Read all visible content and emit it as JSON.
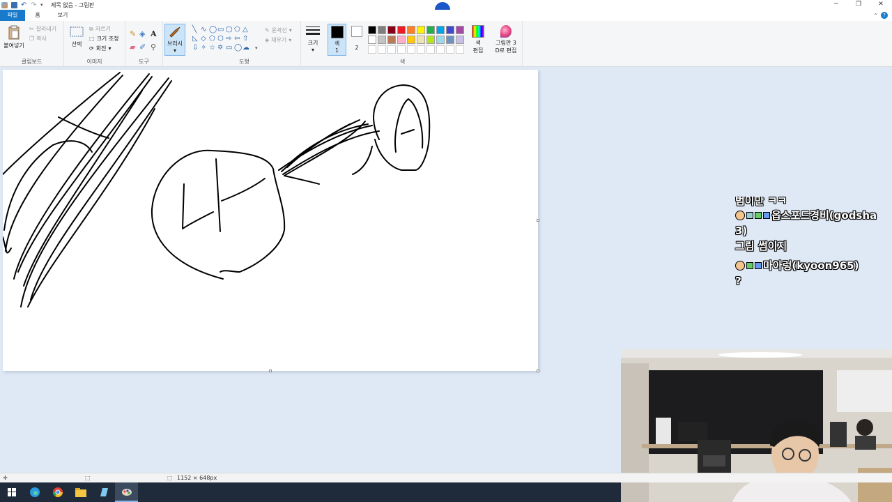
{
  "window": {
    "title": "제목 없음 - 그림판",
    "minimize": "─",
    "maximize": "❐",
    "close": "✕"
  },
  "tabs": [
    "파일",
    "홈",
    "보기"
  ],
  "ribbon": {
    "clipboard": {
      "label": "클립보드",
      "paste": "붙여넣기",
      "cut": "잘라내기",
      "copy": "복사"
    },
    "image": {
      "label": "이미지",
      "select": "선택",
      "crop": "자르기",
      "resize": "크기 조정",
      "rotate": "회전"
    },
    "tools": {
      "label": "도구"
    },
    "brushes": {
      "label": "브러시"
    },
    "shapes": {
      "label": "도형",
      "outline": "윤곽선",
      "fill": "채우기"
    },
    "size": {
      "label": "크기"
    },
    "colors": {
      "label": "색",
      "color1": "색\n1",
      "color1_a": "색",
      "color1_b": "1",
      "color2": "2",
      "edit_colors_a": "색",
      "edit_colors_b": "편집",
      "paint3d_a": "그림판 3",
      "paint3d_b": "D로 편집",
      "palette_row1": [
        "#000000",
        "#7f7f7f",
        "#880015",
        "#ed1c24",
        "#ff7f27",
        "#fff200",
        "#22b14c",
        "#00a2e8",
        "#3f48cc",
        "#a349a4"
      ],
      "palette_row2": [
        "#ffffff",
        "#c3c3c3",
        "#b97a57",
        "#ffaec9",
        "#ffc90e",
        "#efe4b0",
        "#b5e61d",
        "#99d9ea",
        "#7092be",
        "#c8bfe7"
      ]
    }
  },
  "status": {
    "canvas_size": "1152 × 648px"
  },
  "chat": {
    "partial_line": "범이만 ㅋㅋ",
    "messages": [
      {
        "user": "옵스포드경비(godsha",
        "user_cont": "3)",
        "text": "그림 썸이지"
      },
      {
        "user": "마아렁(kyoon965)",
        "text": "?"
      }
    ]
  },
  "taskbar": {
    "items": [
      "start-icon",
      "edge-icon",
      "chrome-icon",
      "file-explorer-icon",
      "notepad-icon",
      "paint-icon"
    ]
  },
  "drawing": {
    "text_in_circle": "나"
  }
}
